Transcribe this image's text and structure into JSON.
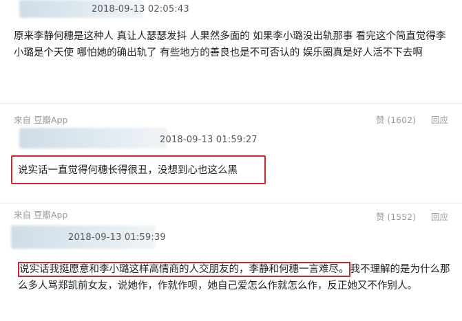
{
  "comments": [
    {
      "time": "2018-09-13 02:05:43",
      "text": "原来李静何穗是这种人 真让人瑟瑟发抖 人果然多面的 如果李小璐没出轨那事 看完这个简直觉得李小璐是个天使 哪怕她的确出轨了 有些地方的善良也是不可否认的 娱乐圈真是好人活不下去啊",
      "source": "来自 豆瓣App",
      "likes": "赞 (1602)",
      "reply": "回应"
    },
    {
      "time": "2018-09-13 01:59:27",
      "text": "说实话一直觉得何穗长得很丑，没想到心也这么黑",
      "source": "来自 豆瓣App",
      "likes": "赞 (1552)",
      "reply": "回应"
    },
    {
      "time": "2018-09-13 01:59:39",
      "text_highlight": "说实话我挺愿意和李小璐这样高情商的人交朋友的，李静和何穗一言难尽。",
      "text_rest": "我不理解的是为什么那么多人骂郑凯前女友，说她作，作就作呗，她自己爱怎么作就怎么作，反正她又不作别人。"
    }
  ],
  "colors": {
    "highlight": "#d8232a"
  }
}
